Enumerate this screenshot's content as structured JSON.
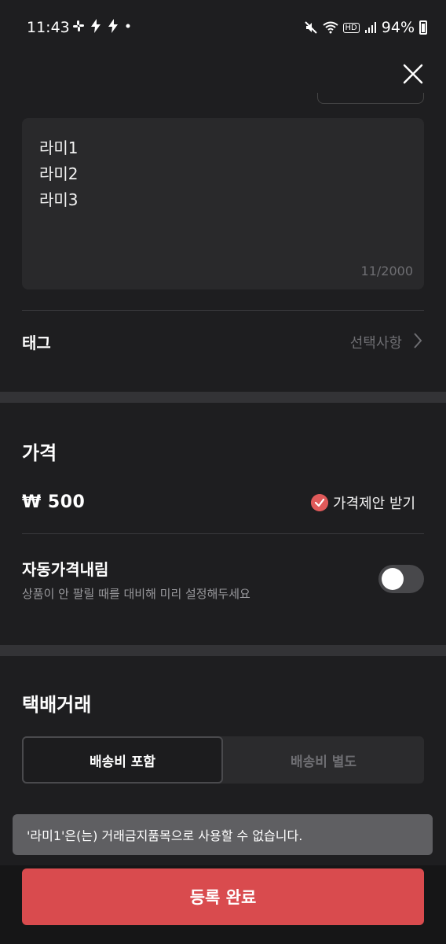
{
  "status_bar": {
    "time": "11:43",
    "left_icons": [
      "slack-icon",
      "bolt-icon",
      "bolt-icon",
      "dot-icon"
    ],
    "right_icons": [
      "mute-icon",
      "wifi-icon",
      "hd-icon",
      "signal-icon"
    ],
    "hd_text": "HD",
    "battery": "94%"
  },
  "description": {
    "text": "라미1\n라미2\n라미3",
    "counter": "11/2000"
  },
  "tag": {
    "label": "태그",
    "value": "선택사항"
  },
  "price": {
    "section_title": "가격",
    "value": "₩ 500",
    "offer_label": "가격제안 받기",
    "offer_checked": true,
    "auto_title": "자동가격내림",
    "auto_desc": "상품이 안 팔릴 때를 대비해 미리 설정해두세요",
    "auto_enabled": false
  },
  "shipping": {
    "section_title": "택배거래",
    "options": [
      "배송비 포함",
      "배송비 별도"
    ],
    "selected": "배송비 포함"
  },
  "toast": "'라미1'은(는) 거래금지품목으로 사용할 수 없습니다.",
  "submit_label": "등록 완료",
  "colors": {
    "background": "#1e1e20",
    "accent": "#d94b4e",
    "check": "#e05a5a"
  }
}
